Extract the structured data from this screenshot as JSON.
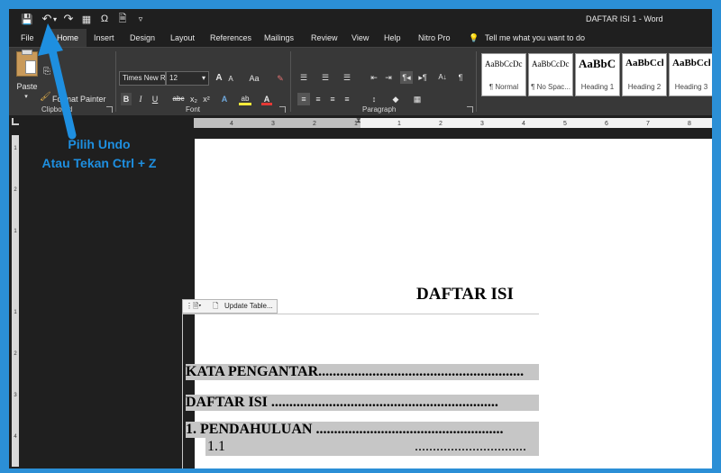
{
  "window": {
    "title": "DAFTAR ISI 1  -  Word"
  },
  "quick_access": {
    "save": "💾",
    "undo": "↶",
    "undo_dropdown": "▾",
    "redo": "↷",
    "table": "▦",
    "symbol": "Ω",
    "doc": "🗎",
    "customize": "▿"
  },
  "menu": {
    "tabs": [
      "File",
      "Home",
      "Insert",
      "Design",
      "Layout",
      "References",
      "Mailings",
      "Review",
      "View",
      "Help",
      "Nitro Pro"
    ],
    "tell_me": "Tell me what you want to do"
  },
  "ribbon": {
    "clipboard": {
      "paste": "Paste",
      "format_painter": "Format Painter",
      "label": "Clipboard"
    },
    "font": {
      "name": "Times New R",
      "size": "12",
      "grow": "A",
      "shrink": "A",
      "case": "Aa",
      "clear": "✎",
      "bold": "B",
      "italic": "I",
      "underline": "U",
      "strike": "abc",
      "sub": "x₂",
      "sup": "x²",
      "effects": "A",
      "highlight": "ab",
      "color": "A",
      "label": "Font"
    },
    "paragraph": {
      "bullets": "☰",
      "numbering": "☰",
      "multilevel": "☰",
      "decrease": "⇤",
      "increase": "⇥",
      "ltr": "¶◂",
      "rtl": "▸¶",
      "sort": "A↓",
      "pilcrow": "¶",
      "align_left": "≡",
      "align_center": "≡",
      "align_right": "≡",
      "justify": "≡",
      "spacing": "↕",
      "shading": "◆",
      "borders": "▦",
      "label": "Paragraph"
    },
    "styles": [
      {
        "sample": "AaBbCcDc",
        "name": "¶ Normal"
      },
      {
        "sample": "AaBbCcDc",
        "name": "¶ No Spac..."
      },
      {
        "sample": "AaBbC",
        "name": "Heading 1"
      },
      {
        "sample": "AaBbCcl",
        "name": "Heading 2"
      },
      {
        "sample": "AaBbCcl",
        "name": "Heading 3"
      }
    ]
  },
  "ruler": {
    "ticks": [
      "4",
      "3",
      "2",
      "1",
      "1",
      "2",
      "3",
      "4",
      "5",
      "6",
      "7",
      "8"
    ],
    "vticks": [
      "1",
      "2",
      "1",
      "1",
      "2",
      "3",
      "4"
    ]
  },
  "document": {
    "title": "DAFTAR ISI",
    "toc_tools": {
      "update": "Update Table..."
    },
    "toc": [
      {
        "text": "KATA PENGANTAR........................................................."
      },
      {
        "text": "DAFTAR ISI ..............................................................."
      },
      {
        "text": "1.    PENDAHULUAN ...................................................."
      }
    ],
    "toc_sub": {
      "num": "1.1",
      "dots": "..............................."
    }
  },
  "annotation": {
    "line1": "Pilih Undo",
    "line2": "Atau Tekan Ctrl + Z"
  },
  "colors": {
    "accent": "#1e8fe0",
    "frame": "#2b8fd6"
  }
}
